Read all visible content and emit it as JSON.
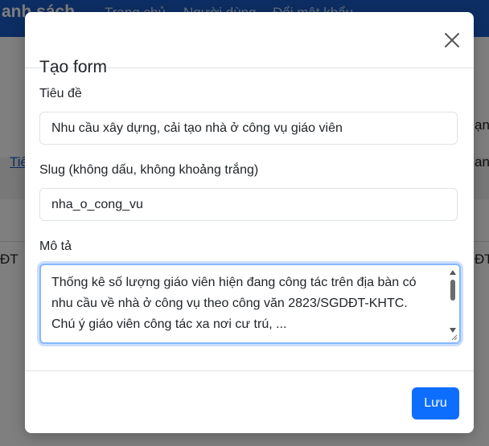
{
  "background": {
    "brand": "anh sách",
    "nav_links": [
      "Trang chủ",
      "Người dùng",
      "Đổi mật khẩu"
    ],
    "fragments": [
      "ạn",
      "Tiế",
      "an",
      "ĐT",
      "ĐT"
    ]
  },
  "modal": {
    "title": "Tạo form",
    "fields": {
      "title_label": "Tiêu đề",
      "title_value": "Nhu cầu xây dựng, cải tạo nhà ở công vụ giáo viên",
      "slug_label": "Slug (không dấu, không khoảng trắng)",
      "slug_value": "nha_o_cong_vu",
      "description_label": "Mô tả",
      "description_value": "Thống kê số lượng giáo viên hiện đang công tác trên địa bàn có nhu cầu về nhà ở công vụ theo công văn 2823/SGDĐT-KHTC. Chú ý giáo viên công tác xa nơi cư trú, ..."
    },
    "save_label": "Lưu"
  },
  "colors": {
    "primary": "#0d6efd",
    "nav_bg": "#1a5cc8",
    "focus_border": "#86b7fe"
  },
  "icons": {
    "close": "close-icon"
  }
}
